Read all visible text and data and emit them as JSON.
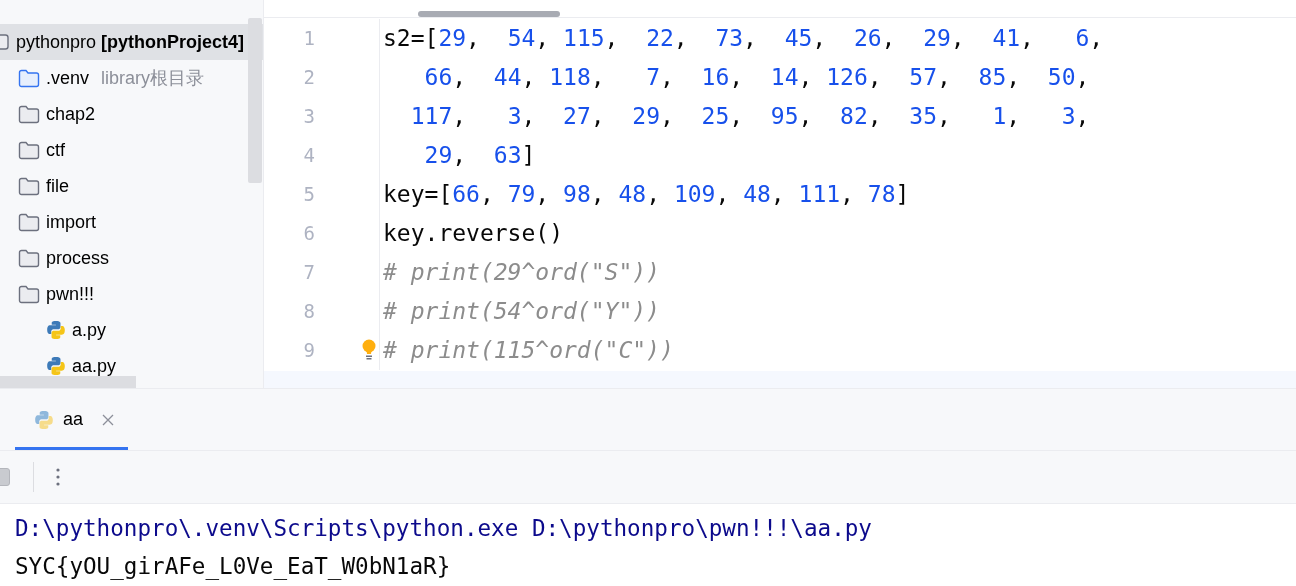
{
  "project_tree": {
    "root": {
      "name": "pythonpro **[pythonProject4]**",
      "kind": "module",
      "selected": true,
      "children": [
        {
          "name": ".venv",
          "hint": "library根目录",
          "kind": "venv-folder",
          "selected": false
        },
        {
          "name": "chap2",
          "kind": "folder",
          "selected": false
        },
        {
          "name": "ctf",
          "kind": "folder",
          "selected": false
        },
        {
          "name": "file",
          "kind": "folder",
          "selected": false
        },
        {
          "name": "import",
          "kind": "folder",
          "selected": false
        },
        {
          "name": "process",
          "kind": "folder",
          "selected": false
        },
        {
          "name": "pwn!!!",
          "kind": "folder",
          "selected": false,
          "children": [
            {
              "name": "a.py",
              "kind": "python-file",
              "selected": false
            },
            {
              "name": "aa.py",
              "kind": "python-file",
              "selected": false
            }
          ]
        }
      ]
    }
  },
  "editor": {
    "lines": [
      {
        "number": "1",
        "text": "s2=[29,  54, 115,  22,  73,  45,  26,  29,  41,   6,",
        "kind": "code"
      },
      {
        "number": "2",
        "text": "   66,  44, 118,   7,  16,  14, 126,  57,  85,  50,",
        "kind": "code"
      },
      {
        "number": "3",
        "text": "  117,   3,  27,  29,  25,  95,  82,  35,   1,   3,",
        "kind": "code"
      },
      {
        "number": "4",
        "text": "   29,  63]",
        "kind": "code"
      },
      {
        "number": "5",
        "text": "key=[66, 79, 98, 48, 109, 48, 111, 78]",
        "kind": "code"
      },
      {
        "number": "6",
        "text": "key.reverse()",
        "kind": "code"
      },
      {
        "number": "7",
        "text": "# print(29^ord(\"S\"))",
        "kind": "comment"
      },
      {
        "number": "8",
        "text": "# print(54^ord(\"Y\"))",
        "kind": "comment"
      },
      {
        "number": "9",
        "text": "# print(115^ord(\"C\"))",
        "kind": "comment",
        "bulb": true
      }
    ]
  },
  "run_panel": {
    "tabs": [
      {
        "label": "aa",
        "selected": true
      }
    ],
    "output": [
      {
        "text": "D:\\pythonpro\\.venv\\Scripts\\python.exe D:\\pythonpro\\pwn!!!\\aa.py",
        "kind": "command"
      },
      {
        "text": "SYC{yOU_girAFe_L0Ve_EaT_W0bN1aR}",
        "kind": "stdout"
      }
    ]
  }
}
